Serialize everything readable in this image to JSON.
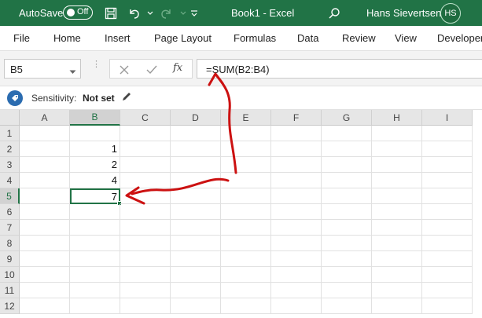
{
  "titlebar": {
    "autosave_label": "AutoSave",
    "autosave_state": "Off",
    "document_title": "Book1  -  Excel",
    "user_name": "Hans Sievertsen",
    "user_initials": "HS",
    "icons": [
      "save-icon",
      "undo-icon",
      "redo-icon",
      "customize-qat-icon",
      "search-icon"
    ],
    "color": "#217346"
  },
  "menu": {
    "items": [
      "File",
      "Home",
      "Insert",
      "Page Layout",
      "Formulas",
      "Data",
      "Review",
      "View",
      "Developer"
    ]
  },
  "formula_bar": {
    "name_box": "B5",
    "formula": "=SUM(B2:B4)",
    "fx_label": "fx",
    "icons": [
      "cancel-icon",
      "enter-icon",
      "insert-function-icon"
    ]
  },
  "sensitivity": {
    "label": "Sensitivity:",
    "value": "Not set",
    "icons": [
      "sensitivity-icon",
      "pencil-icon"
    ]
  },
  "sheet": {
    "columns": [
      "A",
      "B",
      "C",
      "D",
      "E",
      "F",
      "G",
      "H",
      "I"
    ],
    "rows": [
      "1",
      "2",
      "3",
      "4",
      "5",
      "6",
      "7",
      "8",
      "9",
      "10",
      "11",
      "12"
    ],
    "selected_column": "B",
    "selected_row": "5",
    "cells": {
      "B2": "1",
      "B3": "2",
      "B4": "4",
      "B5": "7"
    }
  },
  "annotation": {
    "arrow_color": "#cc1111"
  }
}
